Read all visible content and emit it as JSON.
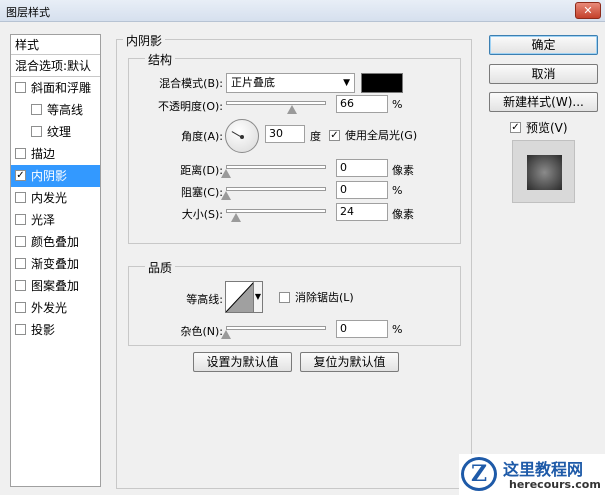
{
  "window": {
    "title": "图层样式",
    "close_glyph": "✕"
  },
  "sidebar": {
    "header": "样式",
    "blend_options": "混合选项:默认",
    "items": [
      {
        "label": "斜面和浮雕",
        "checked": false,
        "indent": false
      },
      {
        "label": "等高线",
        "checked": false,
        "indent": true
      },
      {
        "label": "纹理",
        "checked": false,
        "indent": true
      },
      {
        "label": "描边",
        "checked": false,
        "indent": false
      },
      {
        "label": "内阴影",
        "checked": true,
        "indent": false,
        "selected": true
      },
      {
        "label": "内发光",
        "checked": false,
        "indent": false
      },
      {
        "label": "光泽",
        "checked": false,
        "indent": false
      },
      {
        "label": "颜色叠加",
        "checked": false,
        "indent": false
      },
      {
        "label": "渐变叠加",
        "checked": false,
        "indent": false
      },
      {
        "label": "图案叠加",
        "checked": false,
        "indent": false
      },
      {
        "label": "外发光",
        "checked": false,
        "indent": false
      },
      {
        "label": "投影",
        "checked": false,
        "indent": false
      }
    ]
  },
  "panel": {
    "title": "内阴影",
    "structure": {
      "legend": "结构",
      "blend_mode_label": "混合模式(B):",
      "blend_mode_value": "正片叠底",
      "blend_color": "#000000",
      "opacity_label": "不透明度(O):",
      "opacity_value": "66",
      "opacity_unit": "%",
      "opacity_level": 0.66,
      "angle_label": "角度(A):",
      "angle_value": "30",
      "angle_unit": "度",
      "global_light_label": "使用全局光(G)",
      "global_light_checked": true,
      "distance_label": "距离(D):",
      "distance_value": "0",
      "distance_unit": "像素",
      "distance_level": 0,
      "choke_label": "阻塞(C):",
      "choke_value": "0",
      "choke_unit": "%",
      "choke_level": 0,
      "size_label": "大小(S):",
      "size_value": "24",
      "size_unit": "像素",
      "size_level": 0.096
    },
    "quality": {
      "legend": "品质",
      "contour_label": "等高线:",
      "anti_alias_label": "消除锯齿(L)",
      "anti_alias_checked": false,
      "noise_label": "杂色(N):",
      "noise_value": "0",
      "noise_unit": "%",
      "noise_level": 0
    },
    "make_default": "设置为默认值",
    "reset_default": "复位为默认值"
  },
  "actions": {
    "ok": "确定",
    "cancel": "取消",
    "new_style": "新建样式(W)...",
    "preview_label": "预览(V)",
    "preview_checked": true
  },
  "watermark": {
    "logo_letter": "Z",
    "title": "这里教程网",
    "url": "herecours.com"
  }
}
